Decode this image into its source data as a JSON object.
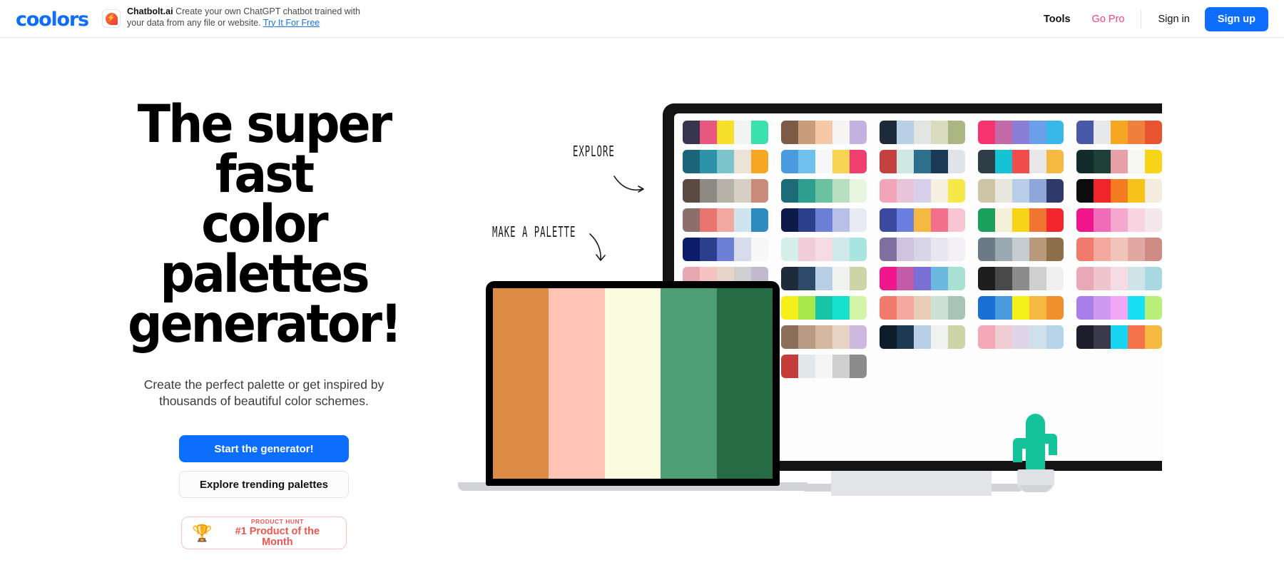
{
  "header": {
    "logo": "coolors",
    "sponsor": {
      "name": "Chatbolt.ai",
      "description": "Create your own ChatGPT chatbot trained with your data from any file or website.",
      "cta": "Try It For Free",
      "icon": "chat-bubble-bolt-icon"
    },
    "nav": {
      "tools": "Tools",
      "go_pro": "Go Pro",
      "sign_in": "Sign in",
      "sign_up": "Sign up"
    }
  },
  "hero": {
    "heading": "The super fast color palettes generator!",
    "heading_lines": [
      "The super fast",
      "color palettes",
      "generator!"
    ],
    "subheading": "Create the perfect palette or get inspired by thousands of beautiful color schemes.",
    "primary_button": "Start the generator!",
    "secondary_button": "Explore trending palettes",
    "product_hunt": {
      "eyebrow": "PRODUCT HUNT",
      "title": "#1 Product of the Month",
      "icon": "trophy-icon",
      "glyph": "🏆"
    }
  },
  "annotations": [
    {
      "text": "EXPLORE",
      "arrow": "curved-arrow-right"
    },
    {
      "text": "MAKE A PALETTE",
      "arrow": "curved-arrow-down"
    }
  ],
  "colors": {
    "accent_blue": "#0d6efd",
    "pro_pink": "#ff3e7f",
    "product_hunt_red": "#f4554f",
    "cactus_green": "#14c39a",
    "device_black": "#141414",
    "stand_gray": "#e3e4e8"
  },
  "laptop_palette": [
    "#dd8a44",
    "#ffc4b3",
    "#fbfbe0",
    "#4e9d74",
    "#256c45"
  ],
  "monitor_palettes": [
    [
      "#36344e",
      "#e8577f",
      "#f7df2c",
      "#f2f4f3",
      "#3ce0ad"
    ],
    [
      "#7d5b47",
      "#c79d7c",
      "#f5c9a7",
      "#f7f4f4",
      "#c3b2e0"
    ],
    [
      "#1d2b3a",
      "#b8cfe6",
      "#e3e5e2",
      "#d9dbbf",
      "#acb685"
    ],
    [
      "#f7336e",
      "#c36ba8",
      "#8a7ed6",
      "#6aa0ea",
      "#37b8e8"
    ],
    [
      "#4759a8",
      "#e7e8ea",
      "#f5a623",
      "#f07f3c",
      "#e8542f"
    ],
    [
      "#e07898",
      "#f0b8cd",
      "#f4dde8",
      "#e3f0df",
      "#b2dde4"
    ],
    [
      "#1c6478",
      "#2e92a8",
      "#7cc4cc",
      "#ece2d8",
      "#f5a623"
    ],
    [
      "#4a9ae0",
      "#6fc0ed",
      "#f6f7f8",
      "#f7d454",
      "#f03f6e"
    ],
    [
      "#c44040",
      "#cfe8e4",
      "#2e6f8c",
      "#1b3a57",
      "#e0e4e8"
    ],
    [
      "#2f3e46",
      "#16c2d5",
      "#f24b4b",
      "#e8e8e8",
      "#f5b841"
    ],
    [
      "#122c2c",
      "#1f4037",
      "#e8a0a8",
      "#f7f7f2",
      "#f7d417"
    ],
    [
      "#0f3a2e",
      "#1d5c40",
      "#cfd8c8",
      "#f0e6d8",
      "#f2c94c"
    ],
    [
      "#5a4a42",
      "#8c8a82",
      "#b7b2a8",
      "#d8cfc4",
      "#c98c7a"
    ],
    [
      "#1d6b78",
      "#2e9e8f",
      "#6cc2a0",
      "#b8e0c0",
      "#e8f5e0"
    ],
    [
      "#f0a6b8",
      "#e8c4d8",
      "#d8d0ea",
      "#f5f0e2",
      "#f7e84a"
    ],
    [
      "#cdc5a5",
      "#e8e6dd",
      "#b8cde8",
      "#8fa6d8",
      "#2f3a6b"
    ],
    [
      "#0c0c0c",
      "#f0262c",
      "#f47c20",
      "#f7c21a",
      "#f5ece0"
    ],
    [
      "#f5a623",
      "#f7d417",
      "#f0637c",
      "#1a6fd4",
      "#1aa05a"
    ],
    [
      "#8c6f6a",
      "#e8756f",
      "#f0a8a0",
      "#cfe4ef",
      "#2e8bc0"
    ],
    [
      "#0d1b4a",
      "#2b3f8c",
      "#6b7fd4",
      "#b8c0e8",
      "#e8eaf5"
    ],
    [
      "#3b4a9e",
      "#6b7fe0",
      "#f5b841",
      "#f2708c",
      "#f7c6d4"
    ],
    [
      "#1aa05a",
      "#f5f0d8",
      "#f7d417",
      "#f07432",
      "#f2262c"
    ],
    [
      "#f0178c",
      "#f06bb8",
      "#f5a8cd",
      "#f7d4e0",
      "#f5e8ed"
    ],
    [
      "#2e7d52",
      "#f5f7e0",
      "#e8f0c8",
      "#f5d4a8",
      "#f0902c"
    ],
    [
      "#0d1b6b",
      "#2b3f8c",
      "#6b7fd4",
      "#d8dcea",
      "#f7f7f7"
    ],
    [
      "#d4f0e8",
      "#f0cdd8",
      "#f5dce4",
      "#cfe8ea",
      "#a8e4e0"
    ],
    [
      "#7d6f9e",
      "#cfc4e0",
      "#d8d4e8",
      "#e8e6f0",
      "#f2f0f5"
    ],
    [
      "#6b7a84",
      "#9aa8b2",
      "#c4ccd2",
      "#b89a7a",
      "#8c6f4a"
    ],
    [
      "#f07a6b",
      "#f5a89e",
      "#f0c4b8",
      "#e0a8a0",
      "#cf8c84"
    ],
    [
      "#e84a7c",
      "#f07ca0",
      "#f5a8c4",
      "#cfe0ea",
      "#a8c4e0"
    ],
    [
      "#e8a8b2",
      "#f5c4c0",
      "#e8d4c8",
      "#cfcfcf",
      "#c4b8cd"
    ],
    [
      "#1d2b3a",
      "#2e4a6b",
      "#b8cfe6",
      "#f0f2f0",
      "#cdd4a8"
    ],
    [
      "#f0178c",
      "#c45ba8",
      "#7a6fd4",
      "#6bb8e0",
      "#a8e0d4"
    ],
    [
      "#1d1d1d",
      "#4a4a4a",
      "#8c8c8c",
      "#cfcfcf",
      "#f0f0f0"
    ],
    [
      "#e8a8b8",
      "#f0c4cd",
      "#f5dce4",
      "#cfe4e8",
      "#a8d8e0"
    ],
    [
      "#f5d417",
      "#f0902c",
      "#1aa05a",
      "#2d5c1d",
      "#0d2b0d"
    ],
    [
      "#0c0c0c",
      "#2b3fa8",
      "#e82c2c",
      "#f7f7f7",
      "#cfcfcf"
    ],
    [
      "#f5f017",
      "#a8e84a",
      "#17c4a8",
      "#17e0cd",
      "#d4f5a8"
    ],
    [
      "#f07a6b",
      "#f5a89e",
      "#e8cdb8",
      "#cfe0d4",
      "#a8c4b8"
    ],
    [
      "#1a6fd4",
      "#4a9ae0",
      "#f5f017",
      "#f5b841",
      "#f0902c"
    ],
    [
      "#a87fe8",
      "#cd9af0",
      "#f0a8f5",
      "#17e0f5",
      "#b8f07a"
    ],
    [
      "#0d1b6b",
      "#3b4ae8",
      "#7a8cf0",
      "#f07cb8",
      "#f5a8cd"
    ],
    [
      "#f5cdb8",
      "#f7e0a8",
      "#f5f0cd",
      "#cfe8d4",
      "#a8d4e0"
    ],
    [
      "#8c6f5a",
      "#b89a84",
      "#d4b8a0",
      "#e8d4c4",
      "#cdb8e0"
    ],
    [
      "#0d1b2a",
      "#1d3a52",
      "#b8cfe6",
      "#f0f2f0",
      "#cdd4a8"
    ],
    [
      "#f5a8b8",
      "#f0cdd4",
      "#e0d4e8",
      "#cfe0ea",
      "#b8d4e8"
    ],
    [
      "#1d1d2b",
      "#3a3a4a",
      "#17d4f0",
      "#f5724a",
      "#f5b841"
    ],
    [
      "#4a9ae0",
      "#6fc0ed",
      "#f7f7f7",
      "#f5d454",
      "#f0406e"
    ],
    [
      "#1c6478",
      "#2e92a8",
      "#7cc4cc",
      "#ece2d8",
      "#f5a623"
    ],
    [
      "#c43c3c",
      "#e0e8ea",
      "#f5f5f5",
      "#cfcfcf",
      "#8c8c8c"
    ]
  ]
}
